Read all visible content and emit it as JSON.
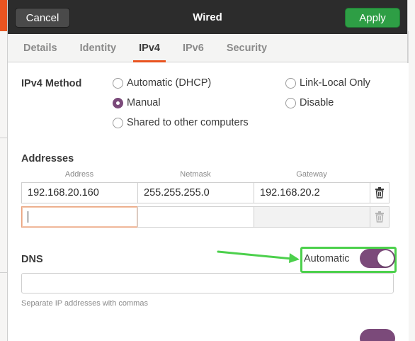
{
  "dialog": {
    "title": "Wired",
    "cancel_label": "Cancel",
    "apply_label": "Apply"
  },
  "tabs": [
    {
      "label": "Details",
      "active": false
    },
    {
      "label": "Identity",
      "active": false
    },
    {
      "label": "IPv4",
      "active": true
    },
    {
      "label": "IPv6",
      "active": false
    },
    {
      "label": "Security",
      "active": false
    }
  ],
  "ipv4": {
    "method_label": "IPv4 Method",
    "methods": [
      {
        "label": "Automatic (DHCP)",
        "checked": false
      },
      {
        "label": "Manual",
        "checked": true
      },
      {
        "label": "Shared to other computers",
        "checked": false
      },
      {
        "label": "Link-Local Only",
        "checked": false
      },
      {
        "label": "Disable",
        "checked": false
      }
    ]
  },
  "addresses": {
    "title": "Addresses",
    "columns": [
      "Address",
      "Netmask",
      "Gateway"
    ],
    "rows": [
      {
        "address": "192.168.20.160",
        "netmask": "255.255.255.0",
        "gateway": "192.168.20.2"
      },
      {
        "address": "",
        "netmask": "",
        "gateway": ""
      }
    ]
  },
  "dns": {
    "title": "DNS",
    "automatic_label": "Automatic",
    "automatic_enabled": true,
    "value": "",
    "hint": "Separate IP addresses with commas"
  },
  "colors": {
    "accent": "#e95420",
    "switch_on": "#7b4a7a",
    "apply_green": "#2e9e45",
    "highlight_green": "#4cd04c"
  }
}
